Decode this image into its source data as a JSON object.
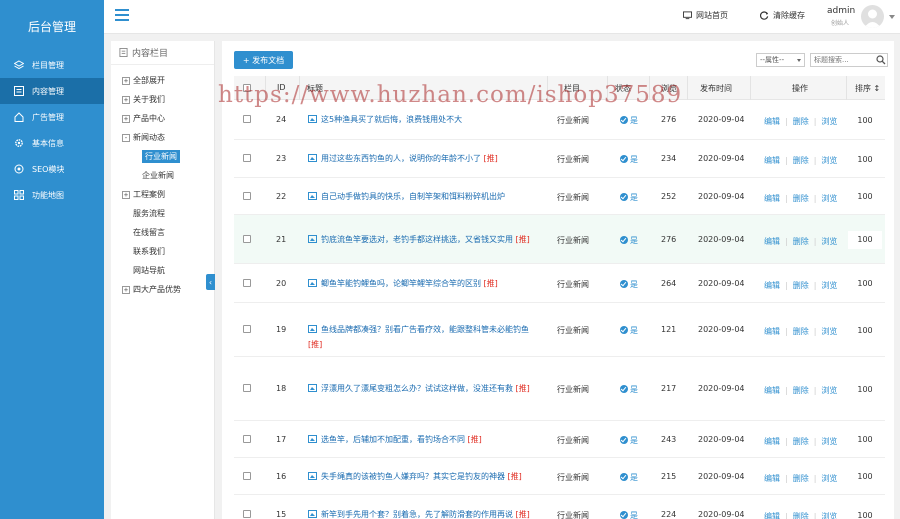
{
  "sidebar": {
    "brand": "后台管理",
    "items": [
      {
        "label": "栏目管理",
        "icon": "layers-icon"
      },
      {
        "label": "内容管理",
        "icon": "list-icon"
      },
      {
        "label": "广告管理",
        "icon": "home-icon"
      },
      {
        "label": "基本信息",
        "icon": "gear-icon"
      },
      {
        "label": "SEO模块",
        "icon": "seo-icon"
      },
      {
        "label": "功能地图",
        "icon": "grid-icon"
      }
    ],
    "active_index": 1
  },
  "topbar": {
    "site_home": "网站首页",
    "clear_cache": "清除缓存",
    "admin_name": "admin",
    "admin_role": "创始人"
  },
  "column_panel": {
    "title": "内容栏目",
    "tree": [
      {
        "label": "全部展开",
        "level": 0,
        "toggle": "+"
      },
      {
        "label": "关于我们",
        "level": 0,
        "toggle": "+"
      },
      {
        "label": "产品中心",
        "level": 0,
        "toggle": "+"
      },
      {
        "label": "新闻动态",
        "level": 0,
        "toggle": "-"
      },
      {
        "label": "行业新闻",
        "level": 2,
        "toggle": "",
        "selected": true
      },
      {
        "label": "企业新闻",
        "level": 2,
        "toggle": ""
      },
      {
        "label": "工程案例",
        "level": 0,
        "toggle": "+"
      },
      {
        "label": "服务流程",
        "level": 1,
        "toggle": ""
      },
      {
        "label": "在线留言",
        "level": 1,
        "toggle": ""
      },
      {
        "label": "联系我们",
        "level": 1,
        "toggle": ""
      },
      {
        "label": "网站导航",
        "level": 1,
        "toggle": ""
      },
      {
        "label": "四大产品优势",
        "level": 0,
        "toggle": "+"
      }
    ],
    "collapse_glyph": "‹"
  },
  "toolbar": {
    "publish_label": "+ 发布文档",
    "attr_select": "--属性--",
    "search_placeholder": "标题搜索..."
  },
  "table": {
    "headers": {
      "id": "ID",
      "title": "标题",
      "column": "栏目",
      "status": "状态",
      "views": "浏览",
      "date": "发布时间",
      "ops": "操作",
      "sort": "排序 ↕"
    },
    "op_labels": [
      "编辑",
      "删除",
      "浏览"
    ],
    "rows": [
      {
        "id": "24",
        "title": "这5种渔具买了就后悔，浪费钱用处不大",
        "tag": "",
        "column": "行业新闻",
        "status": "是",
        "views": "276",
        "date": "2020-09-04",
        "sort": "100"
      },
      {
        "id": "23",
        "title": "用过这些东西钓鱼的人，说明你的年龄不小了",
        "tag": "[推]",
        "column": "行业新闻",
        "status": "是",
        "views": "234",
        "date": "2020-09-04",
        "sort": "100"
      },
      {
        "id": "22",
        "title": "自己动手做钓具的快乐，自制竿架和饵料粉碎机出炉",
        "tag": "",
        "column": "行业新闻",
        "status": "是",
        "views": "252",
        "date": "2020-09-04",
        "sort": "100"
      },
      {
        "id": "21",
        "title": "钓底流鱼竿要选对，老钓手都这样挑选，又省钱又实用",
        "tag": "[推]",
        "column": "行业新闻",
        "status": "是",
        "views": "276",
        "date": "2020-09-04",
        "sort": "100"
      },
      {
        "id": "20",
        "title": "鲫鱼竿能钓鲤鱼吗，论鲫竿鲤竿综合竿的区别",
        "tag": "[推]",
        "column": "行业新闻",
        "status": "是",
        "views": "264",
        "date": "2020-09-04",
        "sort": "100"
      },
      {
        "id": "19",
        "title": "鱼线品牌都凑强？别看广告看疗效，能跟整科管未必能钓鱼",
        "tag": "[推]",
        "column": "行业新闻",
        "status": "是",
        "views": "121",
        "date": "2020-09-04",
        "sort": "100"
      },
      {
        "id": "18",
        "title": "浮漂用久了漂尾变粗怎么办？试试这样做，没准还有救",
        "tag": "[推]",
        "column": "行业新闻",
        "status": "是",
        "views": "217",
        "date": "2020-09-04",
        "sort": "100"
      },
      {
        "id": "17",
        "title": "选鱼竿，后辅加不加配重，看钓场合不同",
        "tag": "[推]",
        "column": "行业新闻",
        "status": "是",
        "views": "243",
        "date": "2020-09-04",
        "sort": "100"
      },
      {
        "id": "16",
        "title": "失手绳真的该被钓鱼人嫌弃吗？其实它是钓友的神器",
        "tag": "[推]",
        "column": "行业新闻",
        "status": "是",
        "views": "215",
        "date": "2020-09-04",
        "sort": "100"
      },
      {
        "id": "15",
        "title": "新竿到手先用个套？别着急，先了解防滑套的作用再说",
        "tag": "[推]",
        "column": "行业新闻",
        "status": "是",
        "views": "224",
        "date": "2020-09-04",
        "sort": "100"
      }
    ]
  },
  "watermark": "https://www.huzhan.com/ishop37589",
  "colors": {
    "accent": "#2f8fcf",
    "sidebar_active": "#1b6fa8",
    "tag_red": "#e02b20"
  }
}
